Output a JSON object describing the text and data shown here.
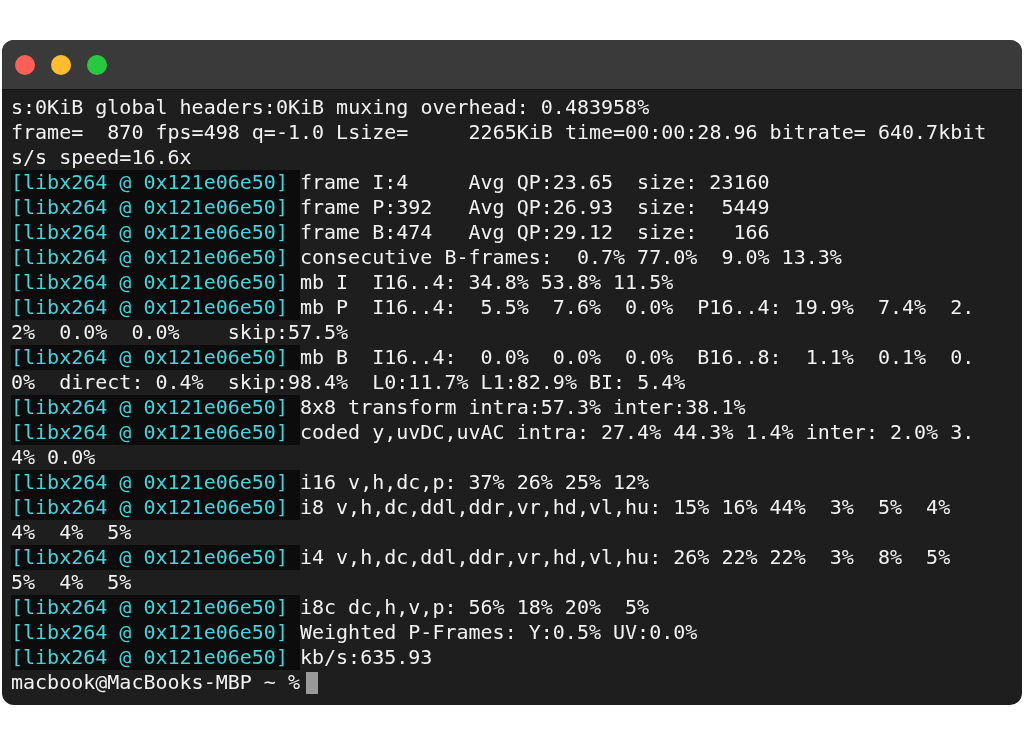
{
  "window": {
    "buttons": [
      {
        "color": "#fe5f57"
      },
      {
        "color": "#febc2e"
      },
      {
        "color": "#28c840"
      }
    ]
  },
  "lines": [
    {
      "text": "s:0KiB global headers:0KiB muxing overhead: 0.483958%"
    },
    {
      "text": "frame=  870 fps=498 q=-1.0 Lsize=     2265KiB time=00:00:28.96 bitrate= 640.7kbit"
    },
    {
      "text": "s/s speed=16.6x"
    },
    {
      "source": "[libx264 @ 0x121e06e50]",
      "text": "frame I:4     Avg QP:23.65  size: 23160"
    },
    {
      "source": "[libx264 @ 0x121e06e50]",
      "text": "frame P:392   Avg QP:26.93  size:  5449"
    },
    {
      "source": "[libx264 @ 0x121e06e50]",
      "text": "frame B:474   Avg QP:29.12  size:   166"
    },
    {
      "source": "[libx264 @ 0x121e06e50]",
      "text": "consecutive B-frames:  0.7% 77.0%  9.0% 13.3%"
    },
    {
      "source": "[libx264 @ 0x121e06e50]",
      "text": "mb I  I16..4: 34.8% 53.8% 11.5%"
    },
    {
      "source": "[libx264 @ 0x121e06e50]",
      "text": "mb P  I16..4:  5.5%  7.6%  0.0%  P16..4: 19.9%  7.4%  2."
    },
    {
      "text": "2%  0.0%  0.0%    skip:57.5%"
    },
    {
      "source": "[libx264 @ 0x121e06e50]",
      "text": "mb B  I16..4:  0.0%  0.0%  0.0%  B16..8:  1.1%  0.1%  0."
    },
    {
      "text": "0%  direct: 0.4%  skip:98.4%  L0:11.7% L1:82.9% BI: 5.4%"
    },
    {
      "source": "[libx264 @ 0x121e06e50]",
      "text": "8x8 transform intra:57.3% inter:38.1%"
    },
    {
      "source": "[libx264 @ 0x121e06e50]",
      "text": "coded y,uvDC,uvAC intra: 27.4% 44.3% 1.4% inter: 2.0% 3."
    },
    {
      "text": "4% 0.0%"
    },
    {
      "source": "[libx264 @ 0x121e06e50]",
      "text": "i16 v,h,dc,p: 37% 26% 25% 12%"
    },
    {
      "source": "[libx264 @ 0x121e06e50]",
      "text": "i8 v,h,dc,ddl,ddr,vr,hd,vl,hu: 15% 16% 44%  3%  5%  4%"
    },
    {
      "text": "4%  4%  5%"
    },
    {
      "source": "[libx264 @ 0x121e06e50]",
      "text": "i4 v,h,dc,ddl,ddr,vr,hd,vl,hu: 26% 22% 22%  3%  8%  5%"
    },
    {
      "text": "5%  4%  5%"
    },
    {
      "source": "[libx264 @ 0x121e06e50]",
      "text": "i8c dc,h,v,p: 56% 18% 20%  5%"
    },
    {
      "source": "[libx264 @ 0x121e06e50]",
      "text": "Weighted P-Frames: Y:0.5% UV:0.0%"
    },
    {
      "source": "[libx264 @ 0x121e06e50]",
      "text": "kb/s:635.93"
    }
  ],
  "prompt": {
    "text": "macbook@MacBooks-MBP ~ %"
  }
}
